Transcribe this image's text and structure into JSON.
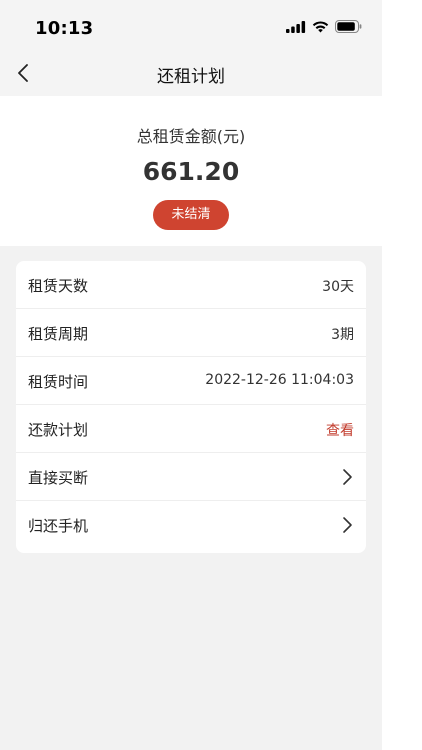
{
  "status_bar": {
    "time": "10:13"
  },
  "nav": {
    "title": "还租计划"
  },
  "summary": {
    "label": "总租赁金额(元)",
    "amount": "661.20",
    "status": "未结清"
  },
  "details": [
    {
      "label": "租赁天数",
      "value": "30天"
    },
    {
      "label": "租赁周期",
      "value": "3期"
    },
    {
      "label": "租赁时间",
      "value": "2022-12-26 11:04:03"
    },
    {
      "label": "还款计划",
      "value": "查看"
    },
    {
      "label": "直接买断"
    },
    {
      "label": "归还手机"
    }
  ],
  "colors": {
    "accent": "#cf4430",
    "link": "#c23b2c",
    "background": "#f2f2f2"
  },
  "icons": [
    "signal-icon",
    "wifi-icon",
    "battery-icon",
    "back-arrow-icon",
    "chevron-right-icon"
  ]
}
